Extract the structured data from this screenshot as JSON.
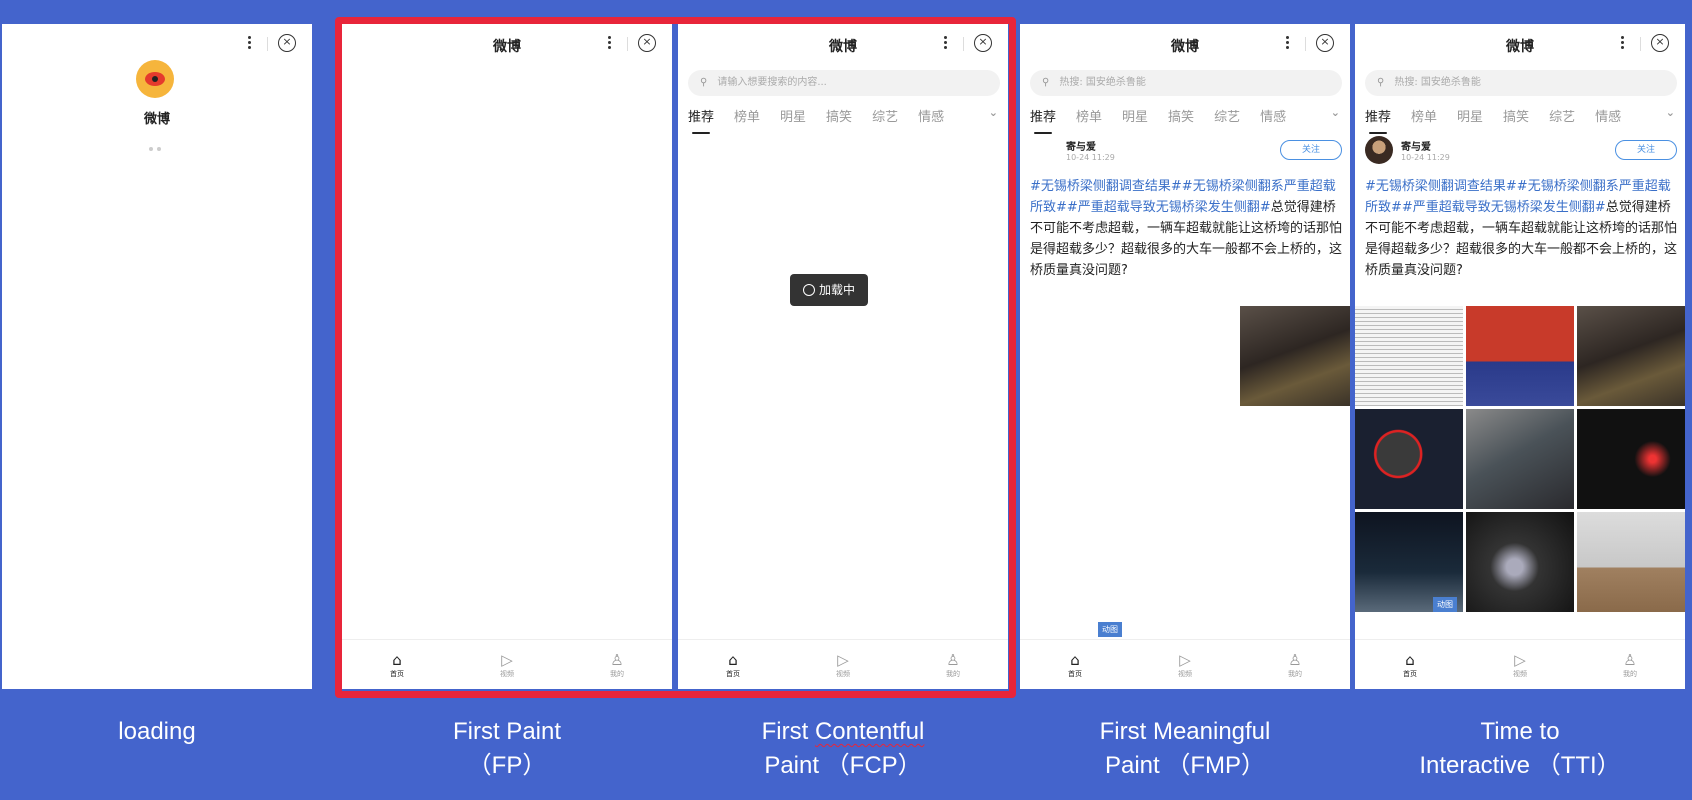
{
  "app_name": "微博",
  "search_placeholder": "请输入想要搜索的内容...",
  "search_hot": "热搜:  国安绝杀鲁能",
  "loading_text": "加载中",
  "tabs": [
    "推荐",
    "榜单",
    "明星",
    "搞笑",
    "综艺",
    "情感"
  ],
  "nav": {
    "home": "首页",
    "video": "视频",
    "me": "我的"
  },
  "post": {
    "user": "寄与爱",
    "time": "10-24 11:29",
    "follow": "关注",
    "tag1": "#无锡桥梁侧翻调查结果#",
    "tag2": "#无锡桥梁侧翻系严重超载所致#",
    "tag3": "#严重超载导致无锡桥梁发生侧翻#",
    "body": "总觉得建桥不可能不考虑超载，一辆车超载就能让这桥垮的话那怕是得超载多少？超载很多的大车一般都不会上桥的，这桥质量真没问题?",
    "gif_badge": "动图"
  },
  "captions": {
    "loading": "loading",
    "fp_line1": "First Paint",
    "fp_line2": "（FP）",
    "fcp_line1a": "First ",
    "fcp_line1b": "Contentful",
    "fcp_line2": "Paint （FCP）",
    "fmp_line1": "First Meaningful",
    "fmp_line2": "Paint （FMP）",
    "tti_line1": "Time to",
    "tti_line2": "Interactive （TTI）"
  },
  "colors": {
    "background": "#4464cc",
    "highlight_frame": "#e8253a",
    "link": "#3a6fc8"
  }
}
